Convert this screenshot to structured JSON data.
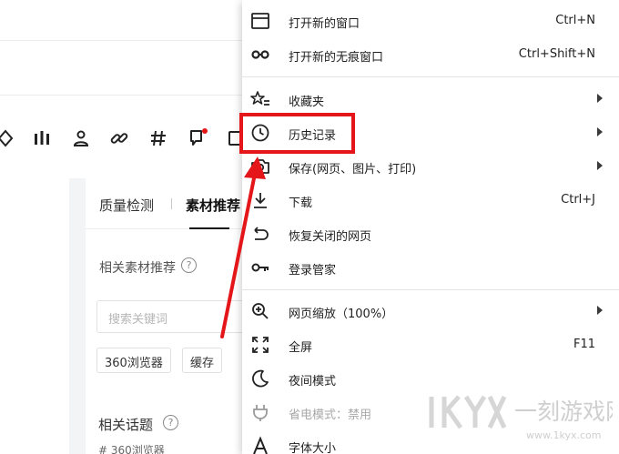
{
  "content": {
    "tabs": [
      "质量检测",
      "素材推荐"
    ],
    "related_material_title": "相关素材推荐",
    "search_placeholder": "搜索关键词",
    "chips": [
      "360浏览器",
      "缓存"
    ],
    "related_topics_title": "相关话题",
    "topic_partial": "# 360浏览器"
  },
  "toolbar_icons": [
    "diamond-icon",
    "bar-chart-icon",
    "person-icon",
    "link-icon",
    "hashtag-icon",
    "flag-icon",
    "box-icon"
  ],
  "menu": {
    "items": [
      {
        "icon": "new-window-icon",
        "label": "打开新的窗口",
        "shortcut": "Ctrl+N"
      },
      {
        "icon": "incognito-icon",
        "label": "打开新的无痕窗口",
        "shortcut": "Ctrl+Shift+N"
      },
      {
        "icon": "star-list-icon",
        "label": "收藏夹",
        "submenu": true
      },
      {
        "icon": "clock-icon",
        "label": "历史记录",
        "submenu": true
      },
      {
        "icon": "camera-icon",
        "label": "保存(网页、图片、打印)",
        "submenu": true
      },
      {
        "icon": "download-icon",
        "label": "下载",
        "shortcut": "Ctrl+J"
      },
      {
        "icon": "restore-icon",
        "label": "恢复关闭的网页"
      },
      {
        "icon": "key-icon",
        "label": "登录管家"
      },
      {
        "icon": "zoom-icon",
        "label": "网页缩放（100%）",
        "submenu": true
      },
      {
        "icon": "fullscreen-icon",
        "label": "全屏",
        "shortcut": "F11"
      },
      {
        "icon": "moon-icon",
        "label": "夜间模式"
      },
      {
        "icon": "plug-icon",
        "label": "省电模式：禁用",
        "disabled": true
      },
      {
        "icon": "font-icon",
        "label": "字体大小"
      }
    ]
  },
  "watermark": {
    "brand": "一刻游戏网",
    "url": "www.1kyx.com",
    "logo": "1KYX"
  },
  "colors": {
    "highlight": "#e4161a",
    "notification_dot": "#e4161a"
  }
}
